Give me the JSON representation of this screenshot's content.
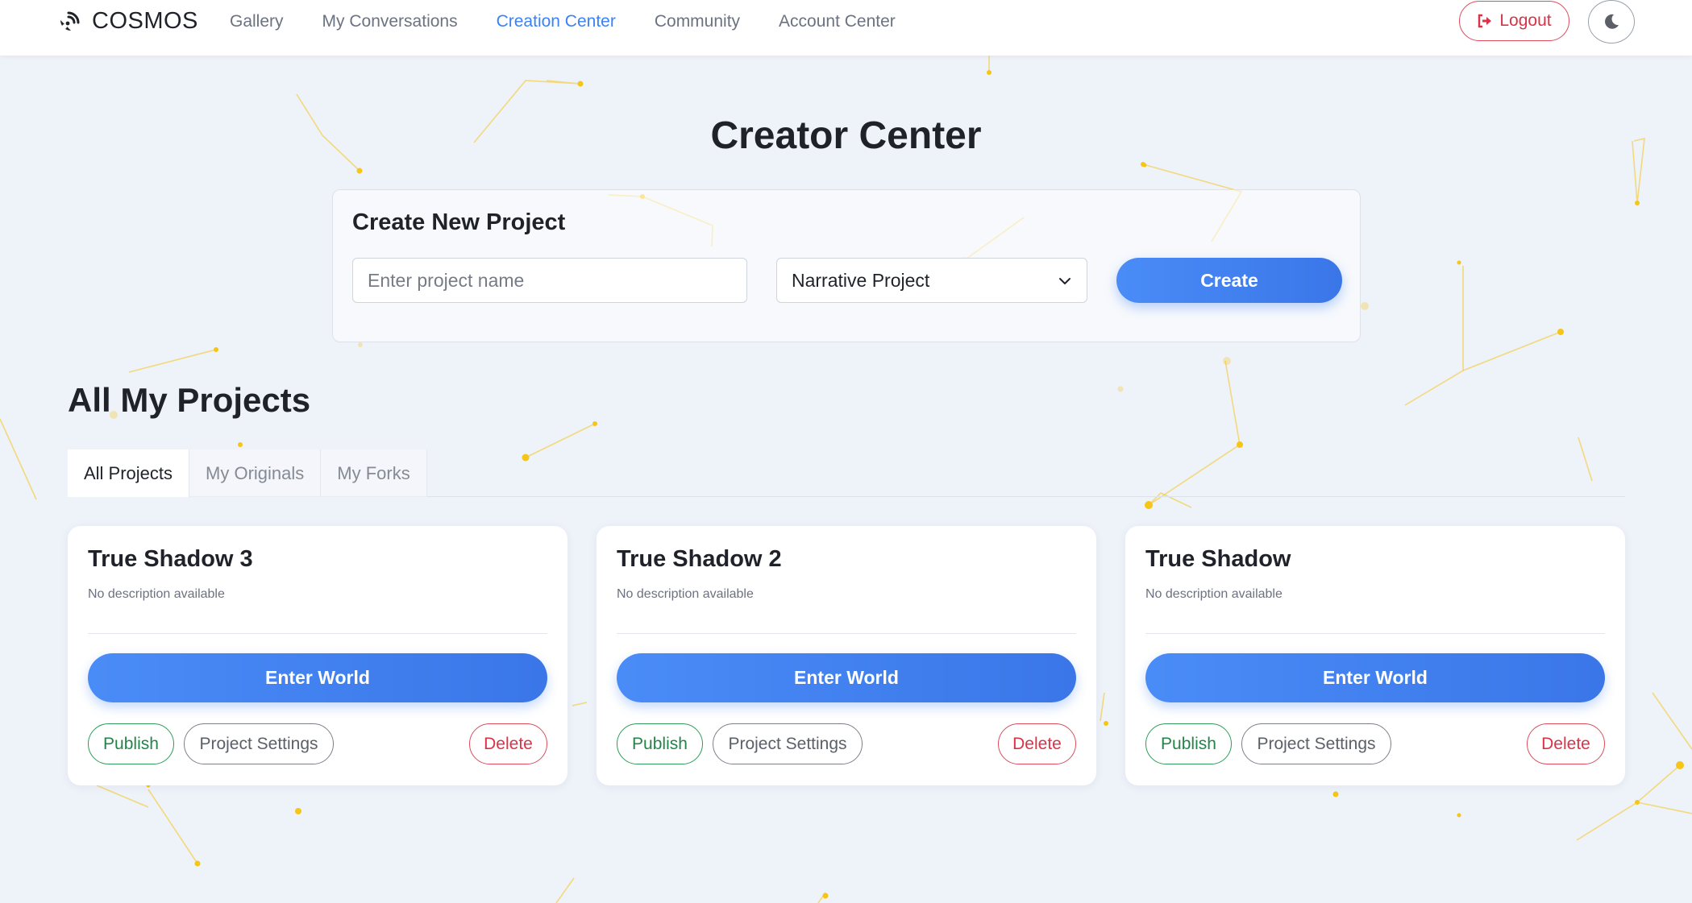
{
  "app": {
    "brand": "COSMOS"
  },
  "nav": {
    "links": [
      "Gallery",
      "My Conversations",
      "Creation Center",
      "Community",
      "Account Center"
    ],
    "active_index": 2,
    "logout_label": "Logout"
  },
  "page": {
    "title": "Creator Center"
  },
  "create_panel": {
    "title": "Create New Project",
    "name_placeholder": "Enter project name",
    "name_value": "",
    "type_selected": "Narrative Project",
    "create_label": "Create"
  },
  "projects": {
    "section_title": "All My Projects",
    "tabs": [
      "All Projects",
      "My Originals",
      "My Forks"
    ],
    "active_tab": 0,
    "cards": [
      {
        "title": "True Shadow 3",
        "description": "No description available",
        "enter_label": "Enter World",
        "publish_label": "Publish",
        "settings_label": "Project Settings",
        "delete_label": "Delete"
      },
      {
        "title": "True Shadow 2",
        "description": "No description available",
        "enter_label": "Enter World",
        "publish_label": "Publish",
        "settings_label": "Project Settings",
        "delete_label": "Delete"
      },
      {
        "title": "True Shadow",
        "description": "No description available",
        "enter_label": "Enter World",
        "publish_label": "Publish",
        "settings_label": "Project Settings",
        "delete_label": "Delete"
      }
    ]
  },
  "colors": {
    "accent": "#3b82f6",
    "danger": "#d93348",
    "success": "#23844a",
    "background": "#eef2f9",
    "network_lines": "#f5c518"
  },
  "icons": {
    "brand": "satellite-dish-icon",
    "logout": "sign-out-icon",
    "theme": "moon-icon",
    "select": "chevron-down-icon"
  }
}
